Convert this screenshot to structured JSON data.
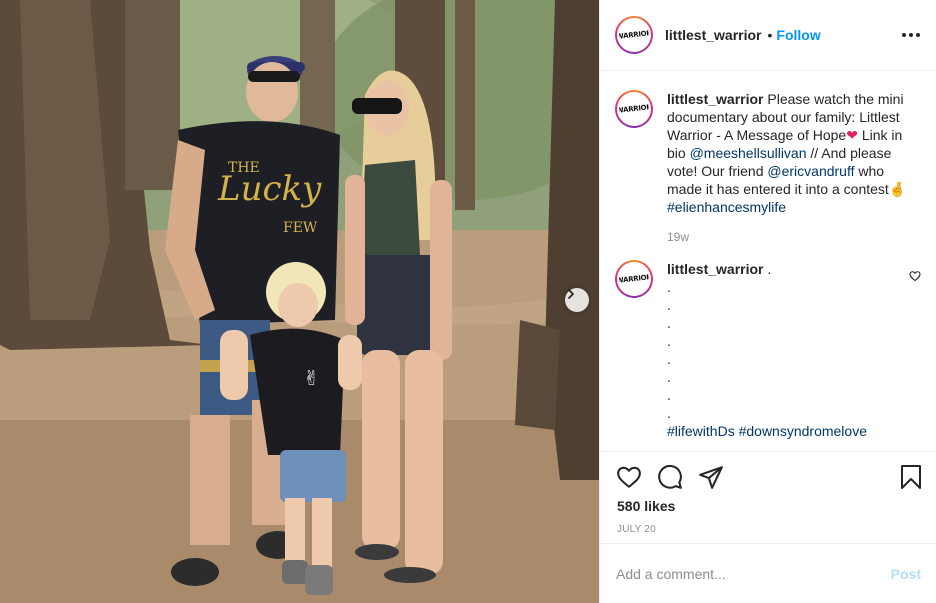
{
  "post": {
    "username": "littlest_warrior",
    "follow_label": "Follow",
    "header_separator": "•",
    "avatar_text": "WARRIOR",
    "more_icon": "more-horizontal-icon"
  },
  "caption": {
    "username": "littlest_warrior",
    "text_1": " Please watch the mini documentary about our family: Littlest Warrior - A Message of Hope",
    "emoji_heart": "❤",
    "text_2": " Link in bio ",
    "mention_1": "@meeshellsullivan",
    "text_3": " // And please vote! Our friend ",
    "mention_2": "@ericvandruff",
    "text_4": " who made it has entered it into a contest",
    "emoji_fingers": "🤞",
    "hashtag": "#elienhancesmylife",
    "time": "19w"
  },
  "comment": {
    "username": "littlest_warrior",
    "text_first": " .",
    "dots": [
      ".",
      ".",
      ".",
      ".",
      ".",
      ".",
      ".",
      "."
    ],
    "hashtags": "#lifewithDs #downsyndromelove"
  },
  "actions": {
    "likes": "580 likes",
    "date": "JULY 20"
  },
  "add_comment": {
    "placeholder": "Add a comment...",
    "post_label": "Post"
  },
  "colors": {
    "link_blue": "#0095f6",
    "mention_navy": "#00376b",
    "post_disabled": "#b2dffc",
    "muted": "#8e8e8e"
  }
}
